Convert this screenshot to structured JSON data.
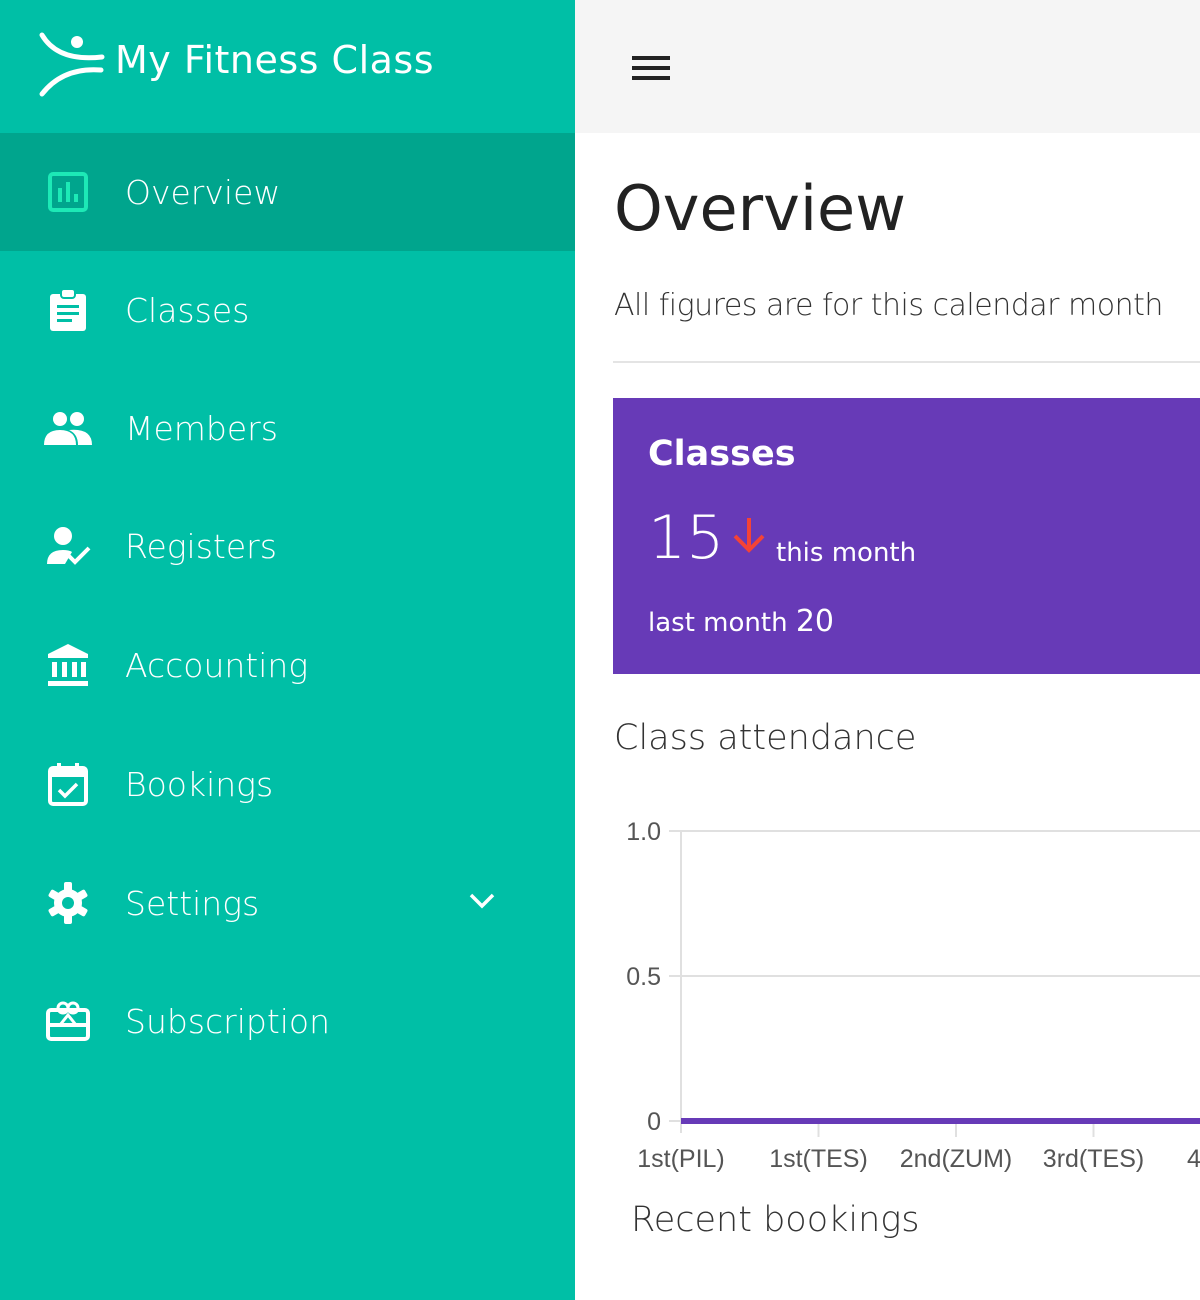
{
  "brand": {
    "name": "My Fitness Class"
  },
  "sidebar": {
    "items": [
      {
        "label": "Overview",
        "icon": "bar-chart-icon",
        "active": true
      },
      {
        "label": "Classes",
        "icon": "clipboard-icon"
      },
      {
        "label": "Members",
        "icon": "people-icon"
      },
      {
        "label": "Registers",
        "icon": "person-check-icon"
      },
      {
        "label": "Accounting",
        "icon": "bank-icon"
      },
      {
        "label": "Bookings",
        "icon": "calendar-check-icon"
      },
      {
        "label": "Settings",
        "icon": "gear-icon",
        "expandable": true
      },
      {
        "label": "Subscription",
        "icon": "gift-card-icon"
      }
    ]
  },
  "header": {
    "menu_icon": "hamburger-icon"
  },
  "main": {
    "title": "Overview",
    "subtitle": "All figures are for this calendar month",
    "card": {
      "title": "Classes",
      "value": "15",
      "trend": "down",
      "this_month_label": "this month",
      "last_month_label": "last month",
      "last_month_value": "20"
    },
    "attendance_title": "Class attendance",
    "bookings_title": "Recent bookings"
  },
  "colors": {
    "sidebar": "#00BFA6",
    "sidebar_active": "#00A58D",
    "card": "#673AB7",
    "trend_down": "#F44336",
    "series": "#673AB7"
  },
  "chart_data": {
    "type": "line",
    "categories": [
      "1st(PIL)",
      "1st(TES)",
      "2nd(ZUM)",
      "3rd(TES)",
      "4"
    ],
    "values": [
      0,
      0,
      0,
      0,
      0
    ],
    "yticks": [
      "0",
      "0.5",
      "1.0"
    ],
    "ylim": [
      0,
      1
    ],
    "grid": true
  }
}
